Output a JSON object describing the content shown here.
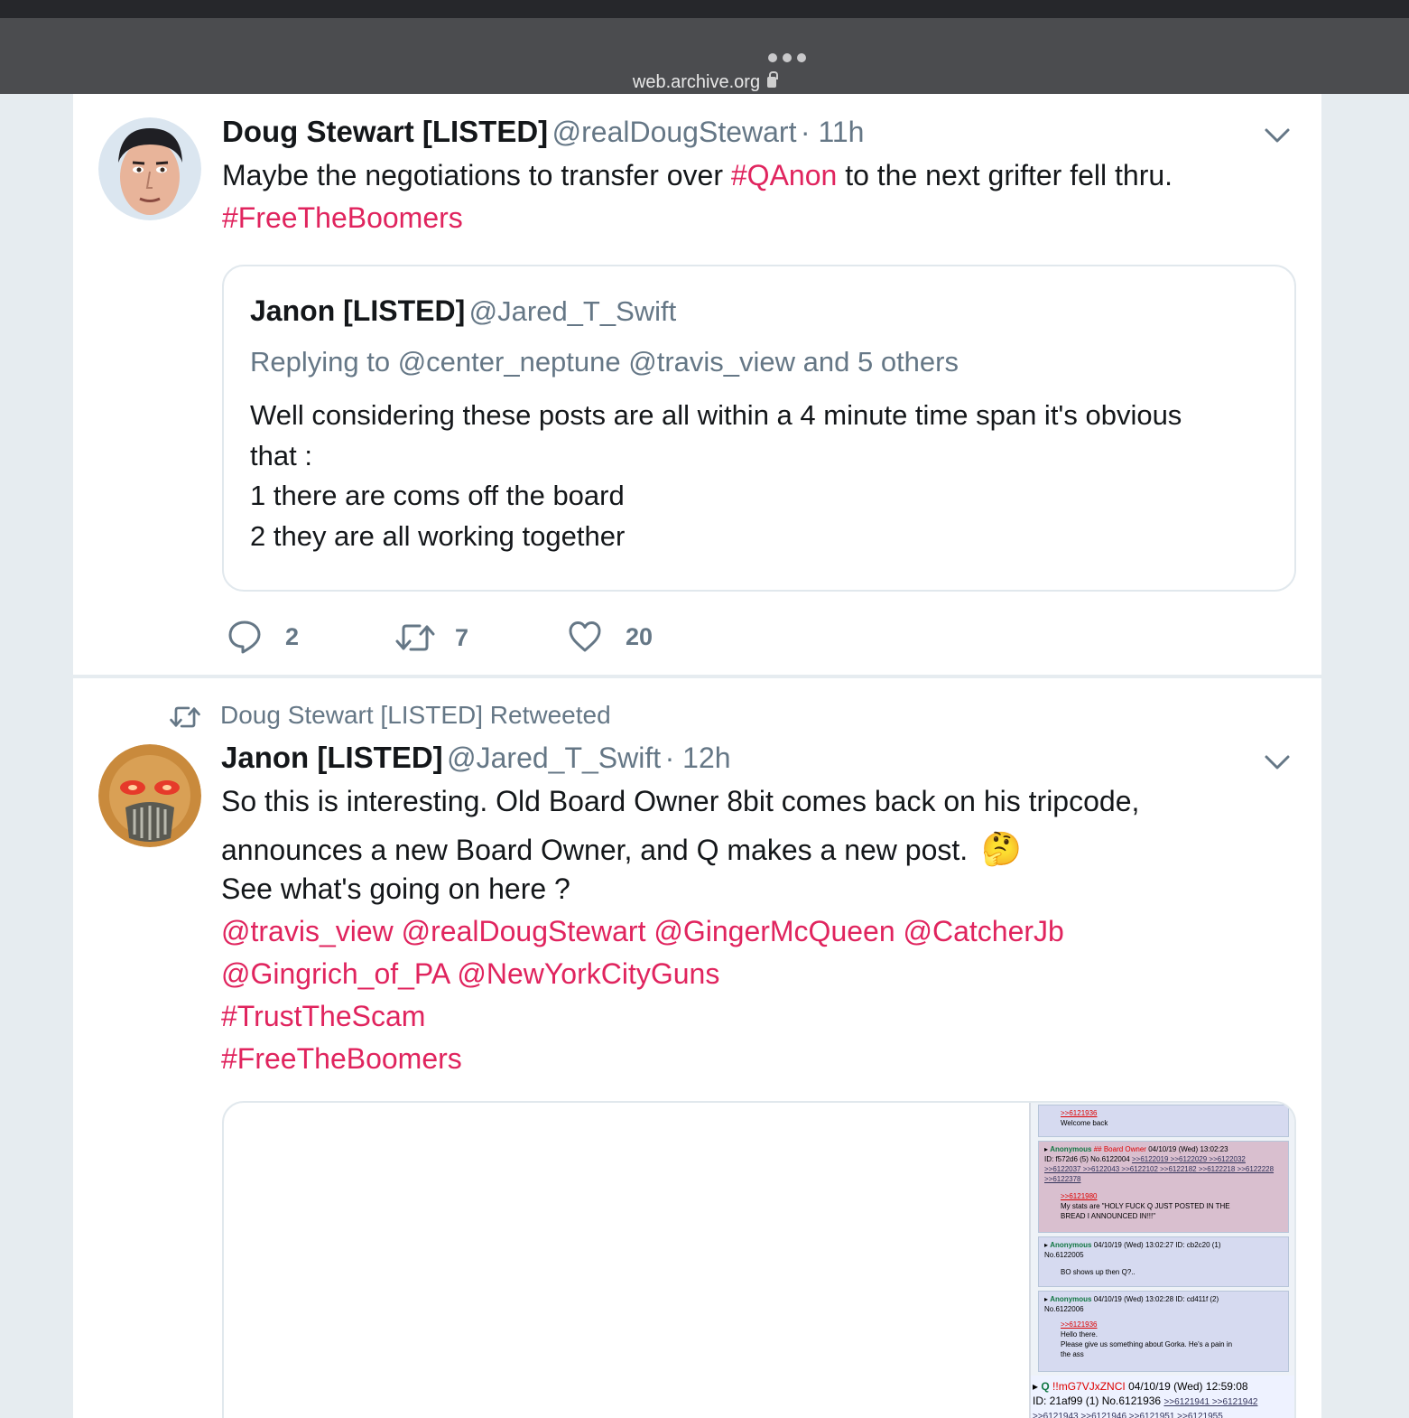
{
  "browser": {
    "url": "web.archive.org"
  },
  "tweet1": {
    "name": "Doug Stewart [LISTED]",
    "handle": "@realDougStewart",
    "time": "· 11h",
    "text_a": "Maybe the negotiations to transfer over ",
    "hashtag_qanon": "#QAnon",
    "text_b": " to the next grifter fell thru.",
    "hashtag_free": "#FreeTheBoomers",
    "quote": {
      "name": "Janon [LISTED]",
      "handle": "@Jared_T_Swift",
      "replying": "Replying to @center_neptune @travis_view and 5 others",
      "line1": "Well considering these posts are all within a 4 minute time span it's obvious",
      "line2": "that :",
      "line3": "1 there are coms off the board",
      "line4": "2 they are all working together"
    },
    "actions": {
      "replies": "2",
      "retweets": "7",
      "likes": "20"
    }
  },
  "tweet2": {
    "retweeted_by": "Doug Stewart [LISTED] Retweeted",
    "name": "Janon [LISTED]",
    "handle": "@Jared_T_Swift",
    "time": "· 12h",
    "line1": "So this is interesting. Old Board Owner 8bit comes back on his tripcode,",
    "line2": "announces a new Board Owner, and Q makes a new post.",
    "emoji": "🤔",
    "line3": "See what's going on here ?",
    "mentions1": "@travis_view @realDougStewart @GingerMcQueen @CatcherJb",
    "mentions2": "@Gingrich_of_PA @NewYorkCityGuns",
    "hashtag_trust": "#TrustTheScam",
    "hashtag_free": "#FreeTheBoomers",
    "media": {
      "p1_link": ">>6121936",
      "p1_text": "Welcome back",
      "p2_name": "Anonymous",
      "p2_role": "## Board Owner",
      "p2_date": "04/10/19 (Wed) 13:02:23",
      "p2_id": "ID: f572d6 (5)  No.6122004",
      "p2_refs1": ">>6122019  >>6122029  >>6122032",
      "p2_refs2": ">>6122037  >>6122043  >>6122102  >>6122182  >>6122218  >>6122228",
      "p2_refs3": ">>6122378",
      "p2_link": ">>6121980",
      "p2_text1": "My stats are \"HOLY FUCK Q JUST POSTED IN THE",
      "p2_text2": "BREAD I ANNOUNCED IN!!!\"",
      "p3_name": "Anonymous",
      "p3_date": "04/10/19 (Wed) 13:02:27 ID: cb2c20 (1)",
      "p3_no": "No.6122005",
      "p3_text": "BO shows up then Q?..",
      "p4_name": "Anonymous",
      "p4_date": "04/10/19 (Wed) 13:02:28 ID: cd411f (2)",
      "p4_no": "No.6122006",
      "p4_link": ">>6121936",
      "p4_text1": "Hello there.",
      "p4_text2": "Please give us something about Gorka. He's a pain in",
      "p4_text3": "the ass",
      "q_name": "Q",
      "q_trip": "!!mG7VJxZNCI",
      "q_date": "04/10/19 (Wed) 12:59:08",
      "q_id": "ID: 21af99 (1)  No.6121936",
      "q_refs": ">>6121941  >>6121942",
      "q_refs2": ">>6121943  >>6121946  >>6121951  >>6121955"
    }
  },
  "colors": {
    "accent": "#e0245e",
    "secondary_text": "#657786",
    "border": "#e1e8ed",
    "background": "#e6ecf0"
  }
}
